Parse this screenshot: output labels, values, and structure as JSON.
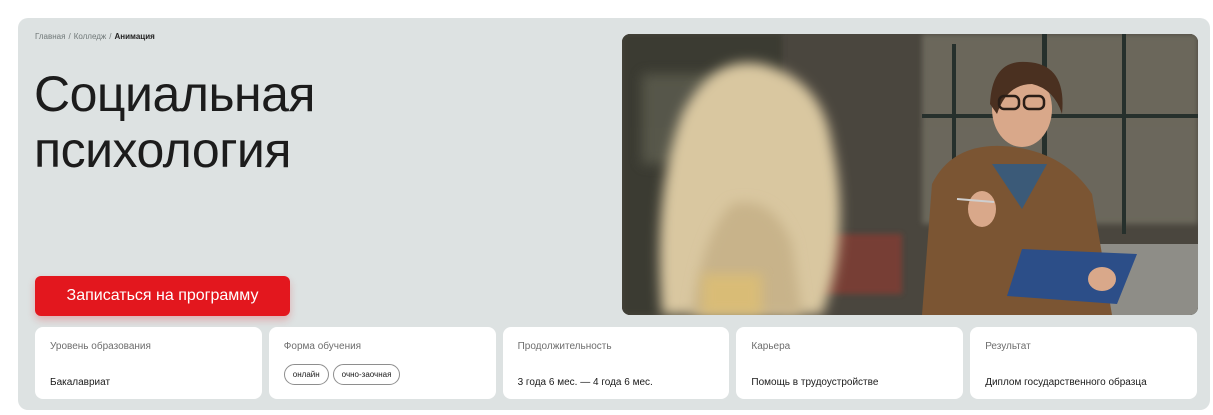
{
  "breadcrumb": {
    "items": [
      "Главная",
      "Колледж"
    ],
    "current": "Анимация",
    "separator": "/"
  },
  "hero": {
    "title_line1": "Социальная",
    "title_line2": "психология",
    "cta_label": "Записаться на программу"
  },
  "cards": [
    {
      "label": "Уровень образования",
      "value": "Бакалавриат"
    },
    {
      "label": "Форма обучения",
      "tags": [
        "онлайн",
        "очно-заочная"
      ]
    },
    {
      "label": "Продолжительность",
      "value": "3 года 6 мес. — 4 года 6 мес."
    },
    {
      "label": "Карьера",
      "value": "Помощь в трудоустройстве"
    },
    {
      "label": "Результат",
      "value": "Диплом государственного образца"
    }
  ],
  "colors": {
    "accent": "#e3171e",
    "hero_background": "#dde2e2",
    "card_background": "#ffffff"
  }
}
